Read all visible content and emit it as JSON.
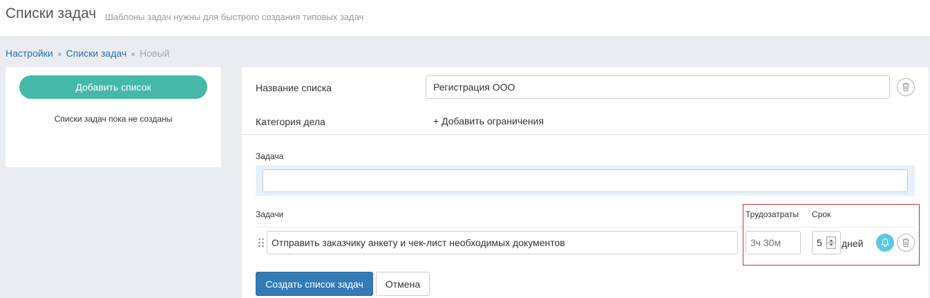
{
  "header": {
    "title": "Списки задач",
    "subtitle": "Шаблоны задач нужны для быстрого создания типовых задач"
  },
  "breadcrumb": {
    "items": [
      "Настройки",
      "Списки задач"
    ],
    "current": "Новый"
  },
  "sidebar": {
    "add_button_label": "Добавить список",
    "empty_text": "Списки задач пока не созданы"
  },
  "form": {
    "list_name_label": "Название списка",
    "list_name_value": "Регистрация ООО",
    "category_label": "Категория дела",
    "add_restrictions_label": "+ Добавить ограничения",
    "task_label": "Задача",
    "task_input_value": "",
    "tasks_header": "Задачи",
    "effort_header": "Трудозатраты",
    "deadline_header": "Срок",
    "tasks": [
      {
        "title": "Отправить заказчику анкету и чек-лист необходимых документов",
        "effort_placeholder": "3ч 30м",
        "deadline_value": "5",
        "deadline_unit": "дней"
      }
    ],
    "submit_label": "Создать список задач",
    "cancel_label": "Отмена"
  },
  "icons": {
    "delete": "trash-icon",
    "drag": "drag-handle-icon",
    "notify": "bell-icon"
  },
  "colors": {
    "teal_button": "#45b8a9",
    "primary_button": "#337ab7",
    "bell": "#5bc9e1",
    "highlight_border": "#c9302c"
  }
}
